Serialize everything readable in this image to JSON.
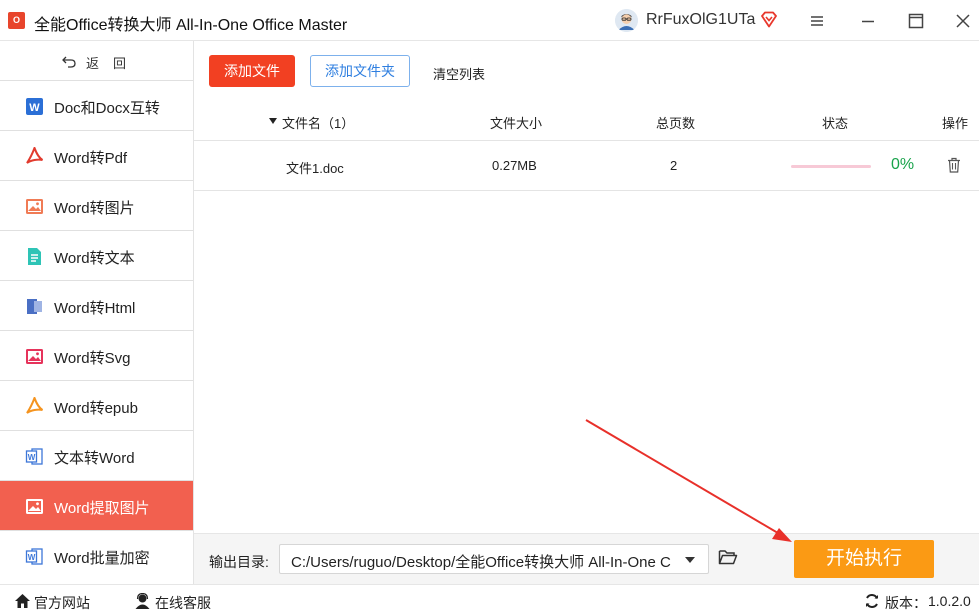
{
  "app": {
    "logo_text": "O",
    "title": "全能Office转换大师 All-In-One Office Master",
    "user_name": "RrFuxOlG1UTa"
  },
  "icons": {
    "window": [
      "menu-icon",
      "minimize-icon",
      "maximize-icon",
      "close-icon"
    ],
    "back": "undo-arrow-icon"
  },
  "sidebar": {
    "back_label": "返回",
    "items": [
      {
        "label": "Doc和Docx互转",
        "icon": "word-doc-icon",
        "active": false
      },
      {
        "label": "Word转Pdf",
        "icon": "pdf-icon",
        "active": false
      },
      {
        "label": "Word转图片",
        "icon": "image-icon",
        "active": false
      },
      {
        "label": "Word转文本",
        "icon": "text-file-icon",
        "active": false
      },
      {
        "label": "Word转Html",
        "icon": "html-icon",
        "active": false
      },
      {
        "label": "Word转Svg",
        "icon": "svg-image-icon",
        "active": false
      },
      {
        "label": "Word转epub",
        "icon": "epub-icon",
        "active": false
      },
      {
        "label": "文本转Word",
        "icon": "word-outline-icon",
        "active": false
      },
      {
        "label": "Word提取图片",
        "icon": "extract-image-icon",
        "active": true
      },
      {
        "label": "Word批量加密",
        "icon": "word-lock-icon",
        "active": false
      }
    ]
  },
  "toolbar": {
    "add_file": "添加文件",
    "add_folder": "添加文件夹",
    "clear_list": "清空列表"
  },
  "table": {
    "headers": {
      "filename": "文件名（1）",
      "size": "文件大小",
      "pages": "总页数",
      "status": "状态",
      "actions": "操作"
    },
    "rows": [
      {
        "filename": "文件1.doc",
        "size": "0.27MB",
        "pages": "2",
        "progress": 0,
        "progress_text": "0%"
      }
    ]
  },
  "output": {
    "label": "输出目录:",
    "path": "C:/Users/ruguo/Desktop/全能Office转换大师 All-In-One C",
    "start_label": "开始执行"
  },
  "statusbar": {
    "website": "官方网站",
    "support": "在线客服",
    "version_label": "版本：",
    "version": "1.0.2.0"
  },
  "colors": {
    "accent_red": "#f24022",
    "active_item": "#f2604f",
    "start_button": "#fb9a14",
    "progress_text": "#19a34b",
    "link_blue": "#2f7fe0"
  }
}
